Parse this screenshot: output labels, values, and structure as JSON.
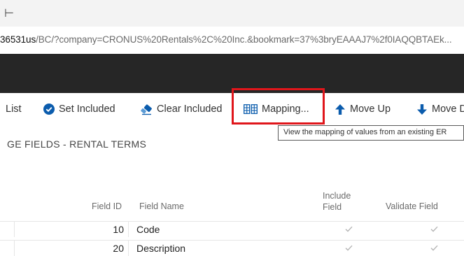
{
  "window": {
    "title_glyph": "⊢"
  },
  "address_bar": {
    "host": "36531us",
    "path": "/BC/?company=CRONUS%20Rentals%2C%20Inc.&bookmark=37%3bryEAAAJ7%2f0IAQQBTAEk..."
  },
  "actions": {
    "list_label": "List",
    "set_included_label": "Set Included",
    "clear_included_label": "Clear Included",
    "mapping_label": "Mapping...",
    "move_up_label": "Move Up",
    "move_down_label": "Move Do"
  },
  "tooltip": {
    "text": "View the mapping of values from an existing ER"
  },
  "section": {
    "title": "GE FIELDS - RENTAL TERMS"
  },
  "table": {
    "columns": {
      "field_id": "Field ID",
      "field_name": "Field Name",
      "include_field_line1": "Include",
      "include_field_line2": "Field",
      "validate_field": "Validate Field"
    },
    "rows": [
      {
        "field_id": "10",
        "field_name": "Code",
        "include": true,
        "validate": true
      },
      {
        "field_id": "20",
        "field_name": "Description",
        "include": true,
        "validate": true
      }
    ]
  },
  "colors": {
    "highlight": "#e0161b",
    "accent_blue": "#0b5cad",
    "check_gray": "#b5b5b5"
  },
  "icons": [
    "check-circle-icon",
    "eraser-icon",
    "mapping-grid-icon",
    "arrow-up-icon",
    "arrow-down-icon",
    "checkmark-icon"
  ]
}
